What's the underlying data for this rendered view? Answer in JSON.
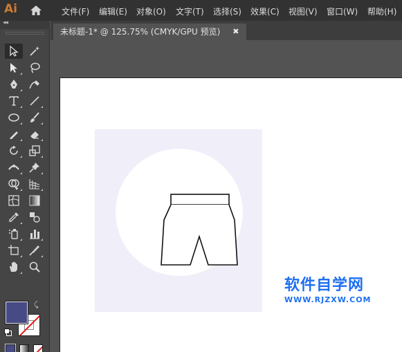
{
  "app": {
    "logo": "Ai"
  },
  "menu": {
    "items": [
      "文件(F)",
      "编辑(E)",
      "对象(O)",
      "文字(T)",
      "选择(S)",
      "效果(C)",
      "视图(V)",
      "窗口(W)",
      "帮助(H)"
    ]
  },
  "document": {
    "tab_title": "未标题-1* @ 125.75% (CMYK/GPU 预览)",
    "close_glyph": "✖"
  },
  "tools": [
    "selection-tool",
    "magic-wand-tool",
    "direct-selection-tool",
    "lasso-tool",
    "pen-tool",
    "curvature-tool",
    "type-tool",
    "line-segment-tool",
    "ellipse-tool",
    "paintbrush-tool",
    "shaper-tool",
    "eraser-tool",
    "rotate-tool",
    "scale-tool",
    "width-tool",
    "puppet-warp-tool",
    "shape-builder-tool",
    "perspective-grid-tool",
    "mesh-tool",
    "gradient-tool",
    "eyedropper-tool",
    "blend-tool",
    "symbol-sprayer-tool",
    "column-graph-tool",
    "artboard-tool",
    "slice-tool",
    "hand-tool",
    "zoom-tool"
  ],
  "colors": {
    "fill": "#474a85",
    "stroke": "none",
    "artboard_background": "#efeef9"
  },
  "watermark": {
    "title": "软件自学网",
    "url": "WWW.RJZXW.COM"
  }
}
